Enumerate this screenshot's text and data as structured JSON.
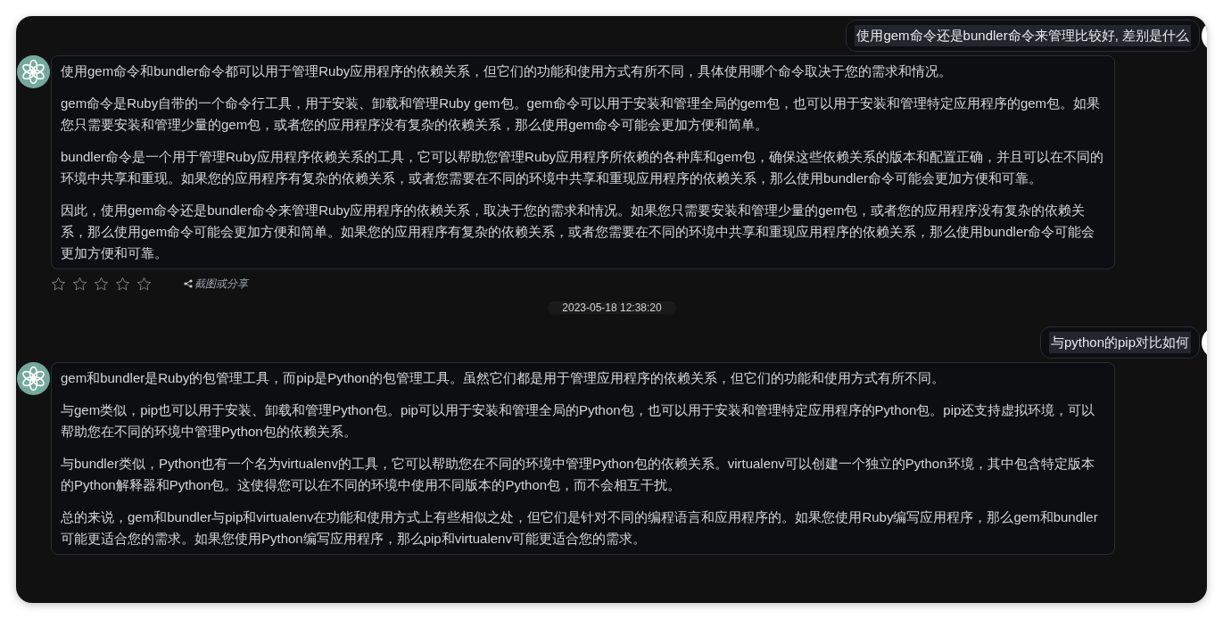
{
  "messages": [
    {
      "kind": "user",
      "text": "使用gem命令还是bundler命令来管理比较好, 差别是什么"
    },
    {
      "kind": "assistant",
      "paragraphs": [
        "使用gem命令和bundler命令都可以用于管理Ruby应用程序的依赖关系，但它们的功能和使用方式有所不同，具体使用哪个命令取决于您的需求和情况。",
        "gem命令是Ruby自带的一个命令行工具，用于安装、卸载和管理Ruby gem包。gem命令可以用于安装和管理全局的gem包，也可以用于安装和管理特定应用程序的gem包。如果您只需要安装和管理少量的gem包，或者您的应用程序没有复杂的依赖关系，那么使用gem命令可能会更加方便和简单。",
        "bundler命令是一个用于管理Ruby应用程序依赖关系的工具，它可以帮助您管理Ruby应用程序所依赖的各种库和gem包，确保这些依赖关系的版本和配置正确，并且可以在不同的环境中共享和重现。如果您的应用程序有复杂的依赖关系，或者您需要在不同的环境中共享和重现应用程序的依赖关系，那么使用bundler命令可能会更加方便和可靠。",
        "因此，使用gem命令还是bundler命令来管理Ruby应用程序的依赖关系，取决于您的需求和情况。如果您只需要安装和管理少量的gem包，或者您的应用程序没有复杂的依赖关系，那么使用gem命令可能会更加方便和简单。如果您的应用程序有复杂的依赖关系，或者您需要在不同的环境中共享和重现应用程序的依赖关系，那么使用bundler命令可能会更加方便和可靠。"
      ],
      "stars": 0,
      "share": "截图或分享"
    },
    {
      "kind": "timestamp",
      "text": "2023-05-18 12:38:20"
    },
    {
      "kind": "user",
      "text": "与python的pip对比如何"
    },
    {
      "kind": "assistant",
      "paragraphs": [
        "gem和bundler是Ruby的包管理工具，而pip是Python的包管理工具。虽然它们都是用于管理应用程序的依赖关系，但它们的功能和使用方式有所不同。",
        "与gem类似，pip也可以用于安装、卸载和管理Python包。pip可以用于安装和管理全局的Python包，也可以用于安装和管理特定应用程序的Python包。pip还支持虚拟环境，可以帮助您在不同的环境中管理Python包的依赖关系。",
        "与bundler类似，Python也有一个名为virtualenv的工具，它可以帮助您在不同的环境中管理Python包的依赖关系。virtualenv可以创建一个独立的Python环境，其中包含特定版本的Python解释器和Python包。这使得您可以在不同的环境中使用不同版本的Python包，而不会相互干扰。",
        "总的来说，gem和bundler与pip和virtualenv在功能和使用方式上有些相似之处，但它们是针对不同的编程语言和应用程序的。如果您使用Ruby编写应用程序，那么gem和bundler可能更适合您的需求。如果您使用Python编写应用程序，那么pip和virtualenv可能更适合您的需求。"
      ]
    }
  ]
}
